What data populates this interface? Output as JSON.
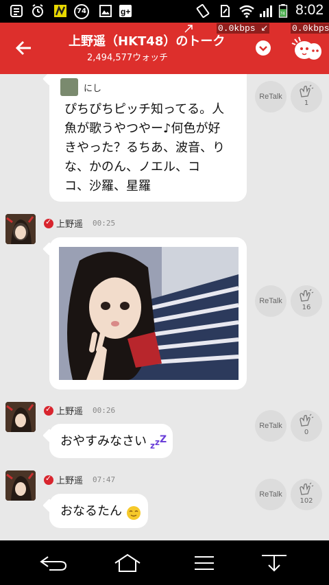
{
  "statusbar": {
    "time": "8:02",
    "battery_level": "74",
    "download_speed": "0.0kbps",
    "upload_speed": "0.0kbps"
  },
  "header": {
    "title": "上野遥（HKT48）のトーク",
    "watch_count": "2,494,577ウォッチ"
  },
  "messages": [
    {
      "type": "quote",
      "quoted_user": "にし",
      "text": "ぴちぴちピッチ知ってる。人魚が歌うやつやー♪何色が好きやった？るちあ、波音、りな、かのん、ノエル、ココ、沙羅、星羅",
      "lines": [
        "ぴちぴちピッチ知ってる。人",
        "魚が歌うやつやー♪何色が好",
        "きやった？るちあ、波音、り",
        "な、かのん、ノエル、コ",
        "コ、沙羅、星羅"
      ],
      "retalk_label": "ReTalk",
      "clap_count": "1"
    },
    {
      "type": "photo",
      "author": "上野遥",
      "time": "00:25",
      "retalk_label": "ReTalk",
      "clap_count": "16"
    },
    {
      "type": "text",
      "author": "上野遥",
      "time": "00:26",
      "text": "おやすみなさい",
      "emoji": "sleep-zzz-emoji",
      "retalk_label": "ReTalk",
      "clap_count": "0"
    },
    {
      "type": "text",
      "author": "上野遥",
      "time": "07:47",
      "text": "おなるたん",
      "emoji": "smile-face-emoji",
      "retalk_label": "ReTalk",
      "clap_count": "102"
    }
  ],
  "colors": {
    "header": "#dd2f2c",
    "background": "#e8e8e8",
    "verified": "#d8252e"
  },
  "icons": {
    "back": "back-arrow-icon",
    "dropdown": "chevron-down-icon",
    "mascot": "mascot-icon",
    "clap": "clap-hands-icon",
    "nav_back": "nav-back-icon",
    "nav_home": "nav-home-icon",
    "nav_menu": "nav-menu-icon",
    "nav_hide": "nav-hide-keyboard-icon"
  }
}
